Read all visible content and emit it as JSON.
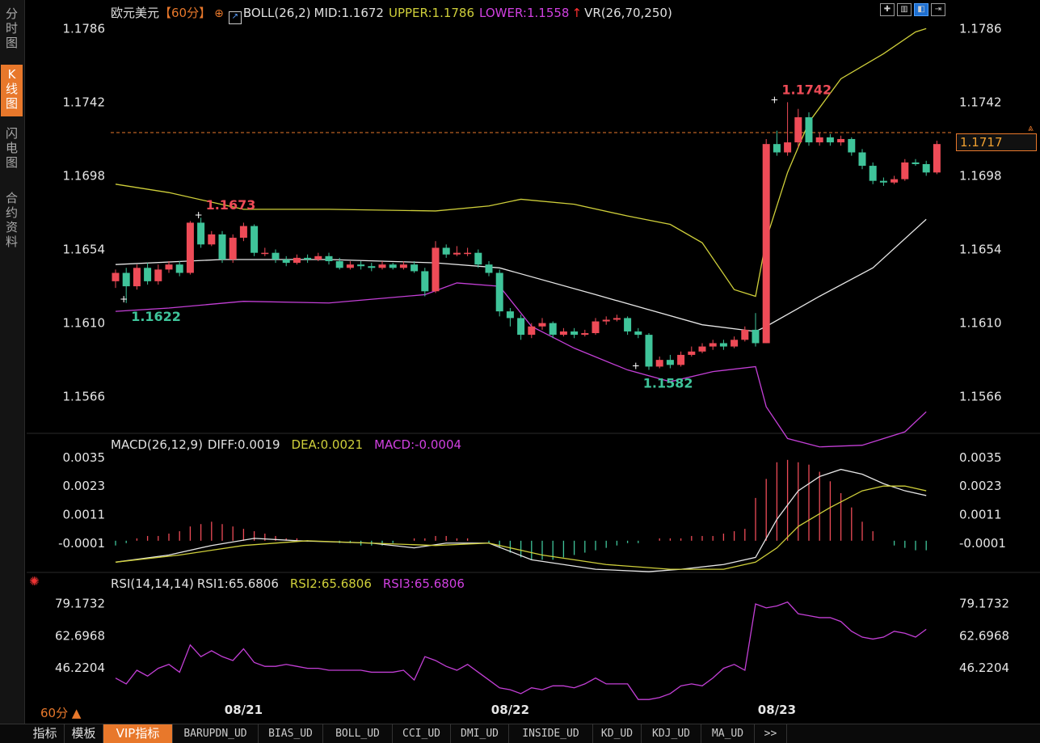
{
  "sidebar": {
    "items": [
      {
        "label": "分\n时\n图",
        "active": false
      },
      {
        "label": "K\n线\n图",
        "active": true
      },
      {
        "label": "闪\n电\n图",
        "active": false
      },
      {
        "label": "合\n约\n资\n料",
        "active": false
      }
    ]
  },
  "main_info": {
    "symbol": "欧元美元",
    "period": "【60分】",
    "boll": "BOLL(26,2)",
    "mid": "MID:1.1672",
    "upper": "UPPER:1.1786",
    "lower": "LOWER:1.1558",
    "vr": "VR(26,70,250)"
  },
  "macd_info": {
    "name": "MACD(26,12,9)",
    "diff": "DIFF:0.0019",
    "dea": "DEA:0.0021",
    "macd": "MACD:-0.0004"
  },
  "rsi_info": {
    "name": "RSI(14,14,14)",
    "rsi1": "RSI1:65.6806",
    "rsi2": "RSI2:65.6806",
    "rsi3": "RSI3:65.6806"
  },
  "current_price": "1.1717",
  "period_label": "60分 ▲",
  "colors": {
    "up": "#ee4b57",
    "down": "#3fc49a",
    "mid": "#e6e6e6",
    "upper": "#cfcf3a",
    "lower": "#c33fd6",
    "dea": "#cfcf3a",
    "rsi": "#c33fd6",
    "accent": "#e8782b",
    "annot_high": "#ee4b57",
    "annot_low": "#3fc49a"
  },
  "chart_data": {
    "type": "candlestick",
    "price_ticks": [
      "1.1786",
      "1.1742",
      "1.1698",
      "1.1654",
      "1.1610",
      "1.1566"
    ],
    "price_ylim": [
      1.1547,
      1.1791
    ],
    "x_tick_labels": [
      "08/21",
      "08/22",
      "08/23"
    ],
    "x_tick_index": [
      12,
      37,
      62
    ],
    "annotations": [
      {
        "label": "1.1673",
        "index": 8,
        "price": 1.1673,
        "kind": "high"
      },
      {
        "label": "1.1622",
        "index": 1,
        "price": 1.1622,
        "kind": "low"
      },
      {
        "label": "1.1742",
        "index": 62,
        "price": 1.1742,
        "kind": "high"
      },
      {
        "label": "1.1582",
        "index": 49,
        "price": 1.1582,
        "kind": "low"
      }
    ],
    "candles": [
      [
        1.1635,
        1.164,
        1.1642,
        1.1631
      ],
      [
        1.164,
        1.1632,
        1.1643,
        1.1622
      ],
      [
        1.1632,
        1.1643,
        1.1645,
        1.163
      ],
      [
        1.1643,
        1.1635,
        1.1646,
        1.1633
      ],
      [
        1.1635,
        1.1642,
        1.1645,
        1.1633
      ],
      [
        1.1642,
        1.1645,
        1.1647,
        1.164
      ],
      [
        1.1645,
        1.164,
        1.1647,
        1.1638
      ],
      [
        1.164,
        1.167,
        1.1671,
        1.1639
      ],
      [
        1.167,
        1.1657,
        1.1673,
        1.1655
      ],
      [
        1.1657,
        1.1663,
        1.1665,
        1.1656
      ],
      [
        1.1663,
        1.1648,
        1.1665,
        1.1646
      ],
      [
        1.1648,
        1.1661,
        1.1663,
        1.1646
      ],
      [
        1.1661,
        1.1668,
        1.167,
        1.1659
      ],
      [
        1.1668,
        1.1652,
        1.1669,
        1.165
      ],
      [
        1.1652,
        1.1652,
        1.1655,
        1.165
      ],
      [
        1.1652,
        1.1648,
        1.1654,
        1.1646
      ],
      [
        1.1648,
        1.1646,
        1.165,
        1.1644
      ],
      [
        1.1646,
        1.1649,
        1.1651,
        1.1645
      ],
      [
        1.1649,
        1.1648,
        1.1651,
        1.1646
      ],
      [
        1.1648,
        1.165,
        1.1652,
        1.1647
      ],
      [
        1.165,
        1.1647,
        1.1652,
        1.1645
      ],
      [
        1.1647,
        1.1643,
        1.1649,
        1.1642
      ],
      [
        1.1643,
        1.1645,
        1.1647,
        1.1642
      ],
      [
        1.1645,
        1.1644,
        1.1647,
        1.1642
      ],
      [
        1.1644,
        1.1643,
        1.1646,
        1.1641
      ],
      [
        1.1643,
        1.1645,
        1.1647,
        1.1642
      ],
      [
        1.1645,
        1.1643,
        1.1646,
        1.1642
      ],
      [
        1.1643,
        1.1645,
        1.1647,
        1.1642
      ],
      [
        1.1645,
        1.1641,
        1.1647,
        1.164
      ],
      [
        1.1641,
        1.1629,
        1.1643,
        1.1626
      ],
      [
        1.1629,
        1.1655,
        1.1659,
        1.1628
      ],
      [
        1.1655,
        1.1651,
        1.1657,
        1.1649
      ],
      [
        1.1651,
        1.1652,
        1.1656,
        1.165
      ],
      [
        1.1652,
        1.1652,
        1.1655,
        1.165
      ],
      [
        1.1652,
        1.1645,
        1.1654,
        1.1643
      ],
      [
        1.1645,
        1.164,
        1.1647,
        1.1638
      ],
      [
        1.164,
        1.1617,
        1.1642,
        1.1614
      ],
      [
        1.1617,
        1.1613,
        1.1619,
        1.1608
      ],
      [
        1.1613,
        1.1603,
        1.1615,
        1.16
      ],
      [
        1.1603,
        1.1608,
        1.161,
        1.1601
      ],
      [
        1.1608,
        1.161,
        1.1613,
        1.1606
      ],
      [
        1.161,
        1.1603,
        1.1611,
        1.1601
      ],
      [
        1.1603,
        1.1605,
        1.1607,
        1.1602
      ],
      [
        1.1605,
        1.1603,
        1.1607,
        1.1601
      ],
      [
        1.1603,
        1.1604,
        1.1606,
        1.1602
      ],
      [
        1.1604,
        1.1611,
        1.1613,
        1.1603
      ],
      [
        1.1611,
        1.1612,
        1.1614,
        1.1609
      ],
      [
        1.1612,
        1.1613,
        1.1615,
        1.1611
      ],
      [
        1.1613,
        1.1605,
        1.1614,
        1.1603
      ],
      [
        1.1605,
        1.1603,
        1.1607,
        1.1601
      ],
      [
        1.1603,
        1.1584,
        1.1604,
        1.1582
      ],
      [
        1.1584,
        1.1588,
        1.159,
        1.1583
      ],
      [
        1.1588,
        1.1585,
        1.1591,
        1.1583
      ],
      [
        1.1585,
        1.1591,
        1.1593,
        1.1584
      ],
      [
        1.1591,
        1.1593,
        1.1596,
        1.159
      ],
      [
        1.1593,
        1.1596,
        1.1598,
        1.1592
      ],
      [
        1.1596,
        1.1598,
        1.16,
        1.1594
      ],
      [
        1.1598,
        1.1596,
        1.16,
        1.1594
      ],
      [
        1.1596,
        1.16,
        1.1602,
        1.1595
      ],
      [
        1.16,
        1.1606,
        1.1608,
        1.1599
      ],
      [
        1.1606,
        1.1598,
        1.1616,
        1.1596
      ],
      [
        1.1598,
        1.1717,
        1.172,
        1.1598
      ],
      [
        1.1717,
        1.1712,
        1.1725,
        1.171
      ],
      [
        1.1712,
        1.1718,
        1.1742,
        1.171
      ],
      [
        1.1718,
        1.1733,
        1.1738,
        1.1715
      ],
      [
        1.1733,
        1.1718,
        1.1736,
        1.1716
      ],
      [
        1.1718,
        1.1721,
        1.1724,
        1.1716
      ],
      [
        1.1721,
        1.1718,
        1.1723,
        1.1716
      ],
      [
        1.1718,
        1.172,
        1.1722,
        1.1716
      ],
      [
        1.172,
        1.1712,
        1.1721,
        1.171
      ],
      [
        1.1712,
        1.1704,
        1.1714,
        1.1702
      ],
      [
        1.1704,
        1.1695,
        1.1706,
        1.1693
      ],
      [
        1.1695,
        1.1694,
        1.1697,
        1.1692
      ],
      [
        1.1694,
        1.1696,
        1.1698,
        1.1693
      ],
      [
        1.1696,
        1.1706,
        1.1708,
        1.1695
      ],
      [
        1.1706,
        1.1705,
        1.1708,
        1.1704
      ],
      [
        1.1705,
        1.17,
        1.1707,
        1.1698
      ],
      [
        1.17,
        1.1717,
        1.1719,
        1.1699
      ]
    ],
    "boll_mid": [
      [
        0,
        1.1645
      ],
      [
        10,
        1.1648
      ],
      [
        20,
        1.1648
      ],
      [
        30,
        1.1646
      ],
      [
        36,
        1.1643
      ],
      [
        45,
        1.1627
      ],
      [
        55,
        1.1609
      ],
      [
        60,
        1.1605
      ],
      [
        61,
        1.1608
      ],
      [
        66,
        1.1626
      ],
      [
        71,
        1.1643
      ],
      [
        76,
        1.1672
      ]
    ],
    "boll_upper": [
      [
        0,
        1.1693
      ],
      [
        5,
        1.1688
      ],
      [
        12,
        1.1678
      ],
      [
        20,
        1.1678
      ],
      [
        30,
        1.1677
      ],
      [
        35,
        1.168
      ],
      [
        38,
        1.1684
      ],
      [
        43,
        1.1681
      ],
      [
        48,
        1.1674
      ],
      [
        52,
        1.1669
      ],
      [
        55,
        1.1658
      ],
      [
        58,
        1.163
      ],
      [
        60,
        1.1626
      ],
      [
        61,
        1.166
      ],
      [
        63,
        1.17
      ],
      [
        65,
        1.173
      ],
      [
        68,
        1.1756
      ],
      [
        72,
        1.1771
      ],
      [
        75,
        1.1784
      ],
      [
        76,
        1.1786
      ]
    ],
    "boll_lower": [
      [
        0,
        1.1617
      ],
      [
        5,
        1.1619
      ],
      [
        12,
        1.1623
      ],
      [
        20,
        1.1622
      ],
      [
        29,
        1.1627
      ],
      [
        32,
        1.1634
      ],
      [
        36,
        1.1632
      ],
      [
        39,
        1.1608
      ],
      [
        43,
        1.1595
      ],
      [
        48,
        1.1582
      ],
      [
        52,
        1.1575
      ],
      [
        56,
        1.1581
      ],
      [
        60,
        1.1584
      ],
      [
        61,
        1.156
      ],
      [
        63,
        1.1541
      ],
      [
        66,
        1.1536
      ],
      [
        70,
        1.1537
      ],
      [
        74,
        1.1545
      ],
      [
        76,
        1.1557
      ]
    ],
    "macd_ticks": [
      "0.0035",
      "0.0023",
      "0.0011",
      "-0.0001"
    ],
    "macd_ylim": [
      -0.0014,
      0.0037
    ],
    "macd_hist": [
      -0.0002,
      -0.0001,
      0.0001,
      0.0002,
      0.0002,
      0.0003,
      0.0004,
      0.0006,
      0.0007,
      0.0008,
      0.0007,
      0.0006,
      0.0005,
      0.0004,
      0.0003,
      0.0002,
      0.0001,
      0.0001,
      0.0,
      0.0,
      0.0,
      -0.0001,
      -0.0001,
      -0.0002,
      -0.0002,
      -0.0002,
      -0.0001,
      0.0,
      0.0001,
      0.0001,
      0.0002,
      0.0002,
      0.0001,
      0.0001,
      0.0,
      -0.0001,
      -0.0003,
      -0.0005,
      -0.0007,
      -0.0008,
      -0.0008,
      -0.0008,
      -0.0007,
      -0.0006,
      -0.0005,
      -0.0004,
      -0.0003,
      -0.0002,
      -0.0001,
      -0.0001,
      0.0,
      0.0001,
      0.0001,
      0.0001,
      0.0002,
      0.0002,
      0.0002,
      0.0003,
      0.0004,
      0.0005,
      0.0018,
      0.0026,
      0.0033,
      0.0034,
      0.0033,
      0.0032,
      0.0029,
      0.0025,
      0.002,
      0.0014,
      0.0008,
      0.0004,
      0.0,
      -0.0002,
      -0.0003,
      -0.0004,
      -0.0004
    ],
    "macd_diff": [
      [
        0,
        -0.0009
      ],
      [
        5,
        -0.0006
      ],
      [
        9,
        -0.0002
      ],
      [
        13,
        0.0001
      ],
      [
        17,
        0.0
      ],
      [
        24,
        -0.0001
      ],
      [
        28,
        -0.0003
      ],
      [
        31,
        -0.0001
      ],
      [
        35,
        -0.0001
      ],
      [
        39,
        -0.0008
      ],
      [
        45,
        -0.0012
      ],
      [
        50,
        -0.0013
      ],
      [
        53,
        -0.0012
      ],
      [
        57,
        -0.001
      ],
      [
        60,
        -0.0007
      ],
      [
        62,
        0.0009
      ],
      [
        64,
        0.0021
      ],
      [
        66,
        0.0027
      ],
      [
        68,
        0.003
      ],
      [
        70,
        0.0028
      ],
      [
        72,
        0.0024
      ],
      [
        74,
        0.0021
      ],
      [
        76,
        0.0019
      ]
    ],
    "macd_dea": [
      [
        0,
        -0.0009
      ],
      [
        6,
        -0.0006
      ],
      [
        12,
        -0.0002
      ],
      [
        18,
        0.0
      ],
      [
        24,
        -0.0001
      ],
      [
        30,
        -0.0002
      ],
      [
        35,
        -0.0001
      ],
      [
        40,
        -0.0006
      ],
      [
        46,
        -0.001
      ],
      [
        52,
        -0.0012
      ],
      [
        57,
        -0.0012
      ],
      [
        60,
        -0.0009
      ],
      [
        62,
        -0.0003
      ],
      [
        64,
        0.0006
      ],
      [
        67,
        0.0014
      ],
      [
        70,
        0.0021
      ],
      [
        72,
        0.0023
      ],
      [
        74,
        0.0023
      ],
      [
        76,
        0.0021
      ]
    ],
    "rsi_ticks": [
      "79.1732",
      "62.6968",
      "46.2204"
    ],
    "rsi_ylim": [
      28,
      84
    ],
    "rsi": [
      41,
      38,
      45,
      42,
      46,
      48,
      44,
      58,
      52,
      55,
      52,
      50,
      56,
      49,
      47,
      47,
      48,
      47,
      46,
      46,
      45,
      45,
      45,
      45,
      44,
      44,
      44,
      45,
      40,
      52,
      50,
      47,
      45,
      48,
      44,
      40,
      36,
      35,
      33,
      36,
      35,
      37,
      37,
      36,
      38,
      41,
      38,
      38,
      38,
      30,
      30,
      31,
      33,
      37,
      38,
      37,
      41,
      46,
      48,
      45,
      79,
      77,
      78,
      80,
      74,
      73,
      72,
      72,
      70,
      65,
      62,
      61,
      62,
      65,
      64,
      62,
      66
    ]
  },
  "bottom_tabs": [
    {
      "label": "指标",
      "active": false
    },
    {
      "label": "模板",
      "active": false
    },
    {
      "label": "VIP指标",
      "active": true
    },
    {
      "label": "BARUPDN_UD",
      "active": false
    },
    {
      "label": "BIAS_UD",
      "active": false
    },
    {
      "label": "BOLL_UD",
      "active": false
    },
    {
      "label": "CCI_UD",
      "active": false
    },
    {
      "label": "DMI_UD",
      "active": false
    },
    {
      "label": "INSIDE_UD",
      "active": false
    },
    {
      "label": "KD_UD",
      "active": false
    },
    {
      "label": "KDJ_UD",
      "active": false
    },
    {
      "label": "MA_UD",
      "active": false
    },
    {
      "label": ">>",
      "active": false
    }
  ]
}
